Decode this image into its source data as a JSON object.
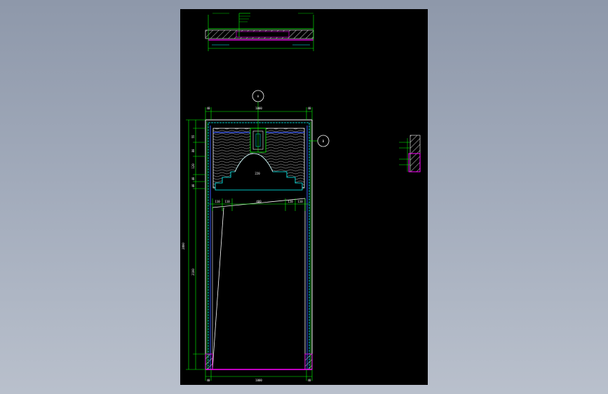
{
  "colors": {
    "background_top": "#8e98aa",
    "background_bottom": "#b9c0cc",
    "sheet": "#000000",
    "dimension": "#00ff00",
    "outline": "#ffffff",
    "cyan": "#00ffff",
    "magenta": "#ff00ff",
    "blue": "#3b5bff",
    "hatch": "#c8c8c8"
  },
  "annotations": {
    "callout_top": "A",
    "callout_right": "B",
    "dim_top_left": "40",
    "dim_top_mid": "1000",
    "dim_top_right": "40",
    "dim_left_total": "2800",
    "dim_left_lower": "2100",
    "dim_bottom_left": "40",
    "dim_bottom_mid": "1000",
    "dim_bottom_right": "40",
    "dim_arch_row": [
      "110",
      "110",
      "400",
      "110",
      "110"
    ],
    "dim_arch_height": "220",
    "dim_left_upper": [
      "55",
      "80",
      "120",
      "40",
      "40"
    ]
  }
}
